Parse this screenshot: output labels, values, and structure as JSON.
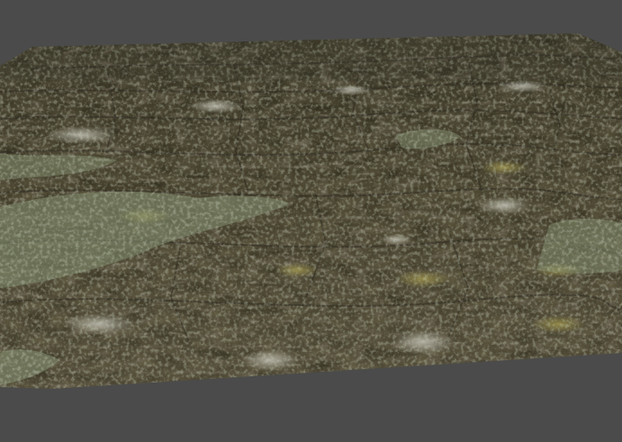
{
  "viewport": {
    "background_color": "#4b4b4b",
    "content": "terrain-render",
    "terrain": {
      "material": "stone-ground-with-moss",
      "base_color": "#6f6a58",
      "shadow_color": "#2f2b22",
      "highlight_color": "#b8b6a6",
      "moss_color": "#8e9a7a",
      "lichen_color": "#9a9048"
    }
  }
}
